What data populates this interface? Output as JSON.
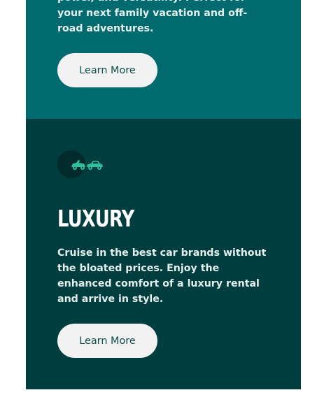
{
  "top_card": {
    "description": "power, and versatility. Perfect for your next family vacation and off-road adventures.",
    "button_label": "Learn More"
  },
  "luxury_card": {
    "icon": "luxury-car-icon",
    "title": "LUXURY",
    "description": "Cruise in the best car brands without the bloated prices. Enjoy the enhanced comfort of a luxury rental and arrive in style.",
    "button_label": "Learn More"
  },
  "colors": {
    "top_card_bg": "#006a6e",
    "luxury_card_bg": "#003d3e",
    "icon_accent": "#2fbf9f",
    "button_bg": "#f2f2f2",
    "button_text": "#0d4c4c"
  }
}
